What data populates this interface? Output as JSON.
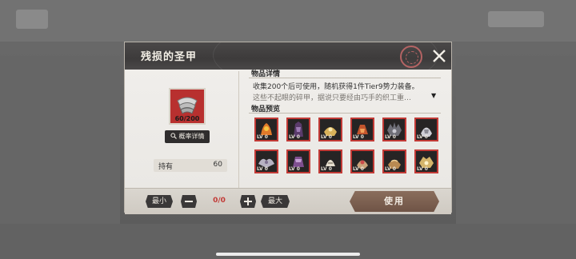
{
  "dialog": {
    "title": "残损的圣甲"
  },
  "item": {
    "count": "60/200",
    "icon": "armor-fragment-icon",
    "probability_button": "概率详情",
    "owned_label": "持有",
    "owned_value": "60"
  },
  "details": {
    "section_title": "物品详情",
    "line1": "收集200个后可使用，随机获得1件Tier9势力装备。",
    "line2": "这些不起眼的碎甲，据说只要经由巧手的织工重…"
  },
  "preview": {
    "section_title": "物品预览",
    "items": [
      {
        "lv": "LV 0",
        "icon": "flame-armor-icon"
      },
      {
        "lv": "LV 0",
        "icon": "dark-armor-icon"
      },
      {
        "lv": "LV 0",
        "icon": "gold-armor-icon"
      },
      {
        "lv": "LV 0",
        "icon": "ember-armor-icon"
      },
      {
        "lv": "LV 0",
        "icon": "spiked-armor-icon"
      },
      {
        "lv": "LV 0",
        "icon": "silver-armor-icon"
      },
      {
        "lv": "LV 0",
        "icon": "wing-armor-icon"
      },
      {
        "lv": "LV 0",
        "icon": "violet-armor-icon"
      },
      {
        "lv": "LV 0",
        "icon": "bone-armor-icon"
      },
      {
        "lv": "LV 0",
        "icon": "rose-armor-icon"
      },
      {
        "lv": "LV 0",
        "icon": "bronze-armor-icon"
      },
      {
        "lv": "LV 0",
        "icon": "gilded-armor-icon"
      }
    ]
  },
  "controls": {
    "min_label": "最小",
    "max_label": "最大",
    "quantity": "0/0",
    "use_label": "使用"
  },
  "colors": {
    "accent_red": "#c23a36",
    "header_dark": "#3d3b3b",
    "use_button": "#7c5f50"
  }
}
